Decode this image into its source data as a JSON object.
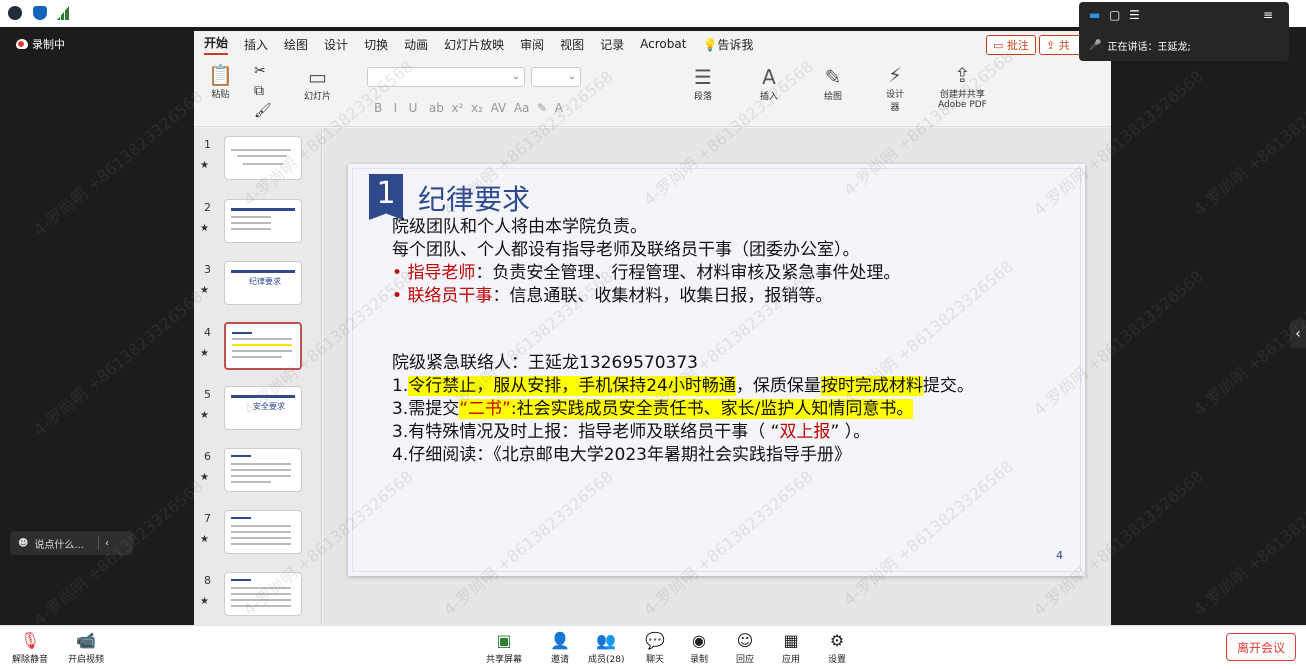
{
  "topbar": {
    "icons": [
      "info-icon",
      "shield-icon",
      "signal-icon"
    ]
  },
  "recording": {
    "label": "录制中"
  },
  "chat": {
    "placeholder": "说点什么..."
  },
  "ppt": {
    "tabs": [
      "开始",
      "插入",
      "绘图",
      "设计",
      "切换",
      "动画",
      "幻灯片放映",
      "审阅",
      "视图",
      "记录",
      "Acrobat",
      "告诉我"
    ],
    "comment_button": "批注",
    "share_button": "共",
    "ribbon": {
      "paste": "粘贴",
      "slide": "幻灯片",
      "paragraph": "段落",
      "insert": "插入",
      "draw": "绘图",
      "designer": "设计\n器",
      "adobe": "创建并共享\nAdobe PDF"
    },
    "thumbs": [
      "1",
      "2",
      "3",
      "4",
      "5",
      "6",
      "7",
      "8"
    ],
    "thumb_titles": {
      "3": "纪律要求",
      "5": "安全要求"
    },
    "slide": {
      "badge": "1",
      "title": "纪律要求",
      "line1": "院级团队和个人将由本学院负责。",
      "line2": "每个团队、个人都设有指导老师及联络员干事（团委办公室）。",
      "bullet1_key": "指导老师",
      "bullet1_text": "：负责安全管理、行程管理、材料审核及紧急事件处理。",
      "bullet2_key": "联络员干事",
      "bullet2_text": "：信息通联、收集材料，收集日报，报销等。",
      "contact": "院级紧急联络人：王延龙13269570373",
      "item1_a": "1.",
      "item1_b": "令行禁止，服从安排，手机保持24小时畅通",
      "item1_c": "，保质保量",
      "item1_d": "按时完成材料",
      "item1_e": "提交。",
      "item3_a": "3.需提交",
      "item3_b": "“二书”",
      "item3_c": ":社会实践成员安全责任书、家长/监护人知情同意书。",
      "item3b_a": "3.有特殊情况及时上报：指导老师及联络员干事（ “",
      "item3b_b": "双上报",
      "item3b_c": "” ）。",
      "item4": "4.仔细阅读：《北京邮电大学2023年暑期社会实践指导手册》",
      "page": "4"
    }
  },
  "floatwin": {
    "speaking": "正在讲话：王延龙;"
  },
  "bottombar": {
    "mute": "解除静音",
    "video": "开启视频",
    "share": "共享屏幕",
    "invite": "邀请",
    "members": "成员(28)",
    "chat": "聊天",
    "record": "录制",
    "reactions": "回应",
    "apps": "应用",
    "settings": "设置",
    "leave": "离开会议"
  },
  "watermark": "4-罗尚明 +8613823326568"
}
